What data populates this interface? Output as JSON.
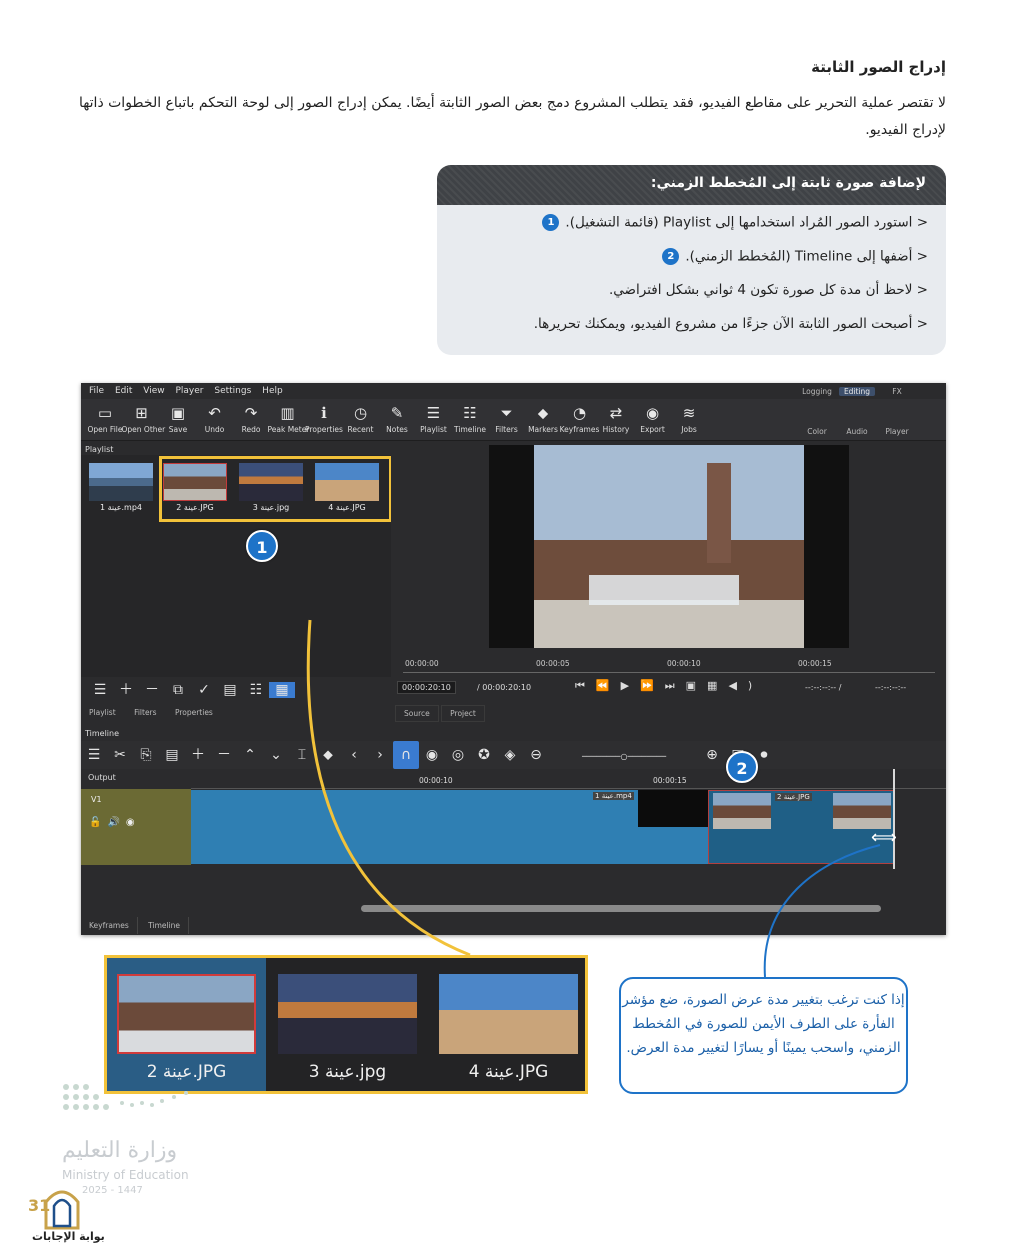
{
  "page": {
    "heading": "إدراج الصور الثابتة",
    "intro": "لا تقتصر عملية التحرير على مقاطع الفيديو، فقد يتطلب المشروع دمج بعض الصور الثابتة أيضًا. يمكن إدراج الصور إلى لوحة التحكم باتباع الخطوات ذاتها لإدراج الفيديو."
  },
  "instructions": {
    "title": "لإضافة صورة ثابتة إلى المُخطط الزمني:",
    "steps": [
      {
        "text": "< استورد الصور المُراد استخدامها إلى Playlist (قائمة التشغيل).",
        "badge": "1"
      },
      {
        "text": "< أضفها إلى Timeline (المُخطط الزمني).",
        "badge": "2"
      },
      {
        "text": "< لاحظ أن مدة كل صورة تكون 4 ثواني بشكل افتراضي.",
        "badge": ""
      },
      {
        "text": "< أصبحت الصور الثابتة الآن جزءًا من مشروع الفيديو، ويمكنك تحريرها.",
        "badge": ""
      }
    ]
  },
  "app": {
    "menu": [
      "File",
      "Edit",
      "View",
      "Player",
      "Settings",
      "Help"
    ],
    "toolbar": [
      {
        "icon": "open-file-icon",
        "glyph": "▭",
        "label": "Open File"
      },
      {
        "icon": "open-other-icon",
        "glyph": "⊞",
        "label": "Open Other"
      },
      {
        "icon": "save-icon",
        "glyph": "▣",
        "label": "Save"
      },
      {
        "icon": "undo-icon",
        "glyph": "↶",
        "label": "Undo"
      },
      {
        "icon": "redo-icon",
        "glyph": "↷",
        "label": "Redo"
      },
      {
        "icon": "peak-meter-icon",
        "glyph": "▥",
        "label": "Peak Meter"
      },
      {
        "icon": "properties-icon",
        "glyph": "ℹ",
        "label": "Properties"
      },
      {
        "icon": "recent-icon",
        "glyph": "◷",
        "label": "Recent"
      },
      {
        "icon": "notes-icon",
        "glyph": "✎",
        "label": "Notes"
      },
      {
        "icon": "playlist-icon",
        "glyph": "☰",
        "label": "Playlist"
      },
      {
        "icon": "timeline-icon",
        "glyph": "☷",
        "label": "Timeline"
      },
      {
        "icon": "filters-icon",
        "glyph": "⏷",
        "label": "Filters"
      },
      {
        "icon": "markers-icon",
        "glyph": "⬥",
        "label": "Markers"
      },
      {
        "icon": "keyframes-icon",
        "glyph": "◔",
        "label": "Keyframes"
      },
      {
        "icon": "history-icon",
        "glyph": "⇄",
        "label": "History"
      },
      {
        "icon": "export-icon",
        "glyph": "◉",
        "label": "Export"
      },
      {
        "icon": "jobs-icon",
        "glyph": "≋",
        "label": "Jobs"
      }
    ],
    "modes_top": [
      "Logging",
      "Editing",
      "FX"
    ],
    "modes_bottom": [
      "Color",
      "Audio",
      "Player"
    ],
    "playlist_title": "Playlist",
    "playlist_items": [
      {
        "caption": "عينة 1.mp4",
        "thumb": "city"
      },
      {
        "caption": "عينة 2.JPG",
        "thumb": "fort"
      },
      {
        "caption": "عينة 3.jpg",
        "thumb": "night"
      },
      {
        "caption": "عينة 4.JPG",
        "thumb": "wall"
      }
    ],
    "ruler_ticks": [
      "00:00:00",
      "00:00:05",
      "00:00:10",
      "00:00:15"
    ],
    "timecode_current": "00:00:20:10",
    "timecode_total": "/ 00:00:20:10",
    "timecode_right": "--:--:--:-- /",
    "timecode_right2": "--:--:--:--",
    "playlist_tabs": [
      "Playlist",
      "Filters",
      "Properties"
    ],
    "source_tabs": [
      "Source",
      "Project"
    ],
    "timeline_title": "Timeline",
    "output_label": "Output",
    "track_label": "V1",
    "timeline_ticks": [
      "00:00:10",
      "00:00:15"
    ],
    "clip1_label": "عينة 1.mp4",
    "clip2_label": "عينة 2.JPG",
    "bottom_tabs": [
      "Keyframes",
      "Timeline"
    ],
    "callout1": "1",
    "callout2": "2"
  },
  "zoom_items": [
    {
      "caption": "عينة 2.JPG",
      "thumb": "fort"
    },
    {
      "caption": "عينة 3.jpg",
      "thumb": "night"
    },
    {
      "caption": "عينة 4.JPG",
      "thumb": "wall"
    }
  ],
  "tip": "إذا كنت ترغب بتغيير مدة عرض الصورة، ضع مؤشر الفأرة على الطرف الأيمن للصورة في المُخطط الزمني، واسحب يمينًا أو يسارًا لتغيير مدة العرض.",
  "footer": {
    "ministry_ar": "وزارة التعليم",
    "ministry_en": "Ministry of Education",
    "year": "2025 - 1447",
    "page_number": "31",
    "site": "بوابة الإجابات"
  },
  "colors": {
    "accent_blue": "#1e73c8",
    "highlight_yellow": "#f2c23a",
    "clip_blue": "#2f7fb3"
  }
}
